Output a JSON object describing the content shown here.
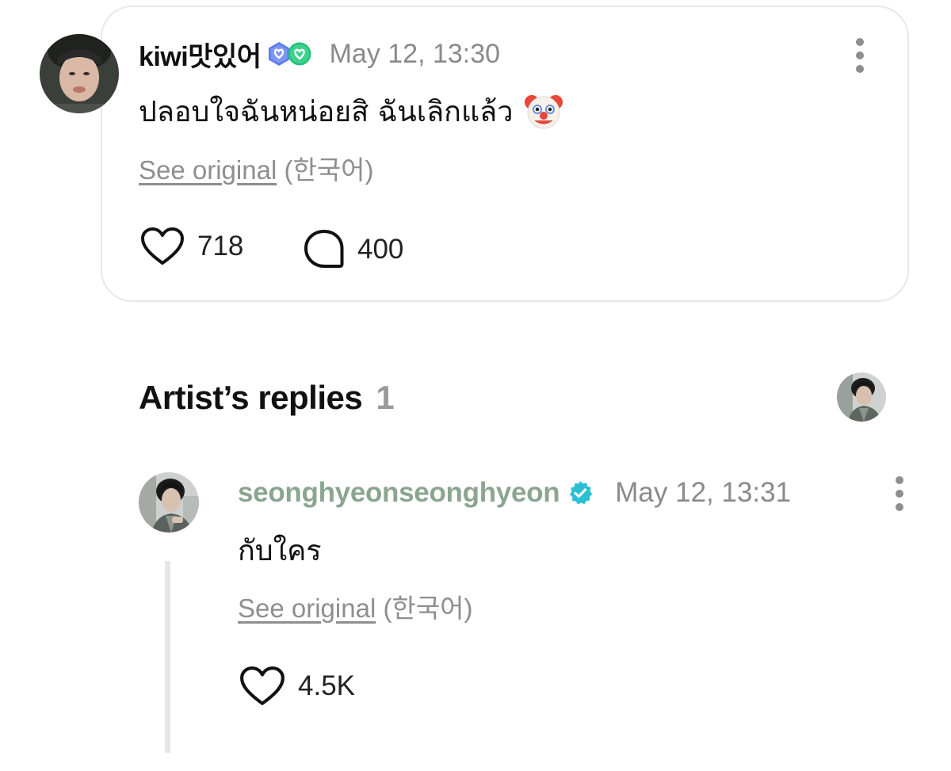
{
  "post": {
    "username": "kiwi맛있어",
    "badges": [
      "membership-badge-icon",
      "heart-badge-icon"
    ],
    "timestamp": "May 12, 13:30",
    "text": "ปลอบใจฉันหน่อยสิ ฉันเลิกแล้ว",
    "emoji": "clown-face-emoji",
    "see_original": "See original",
    "original_language": "(한국어)",
    "likes": "718",
    "comments": "400"
  },
  "artist_replies": {
    "title": "Artist’s replies",
    "count": "1"
  },
  "reply": {
    "username": "seonghyeonseonghyeon",
    "verified_icon": "verified-badge-icon",
    "timestamp": "May 12, 13:31",
    "text": "กับใคร",
    "see_original": "See original",
    "original_language": "(한국어)",
    "likes": "4.5K"
  },
  "colors": {
    "artist_name": "#8ba590",
    "muted": "#8a8a8a",
    "verified": "#2bbfd6",
    "badge_left": "#5b7cf0",
    "badge_right": "#21c17a",
    "card_border": "#e7e7e7"
  }
}
